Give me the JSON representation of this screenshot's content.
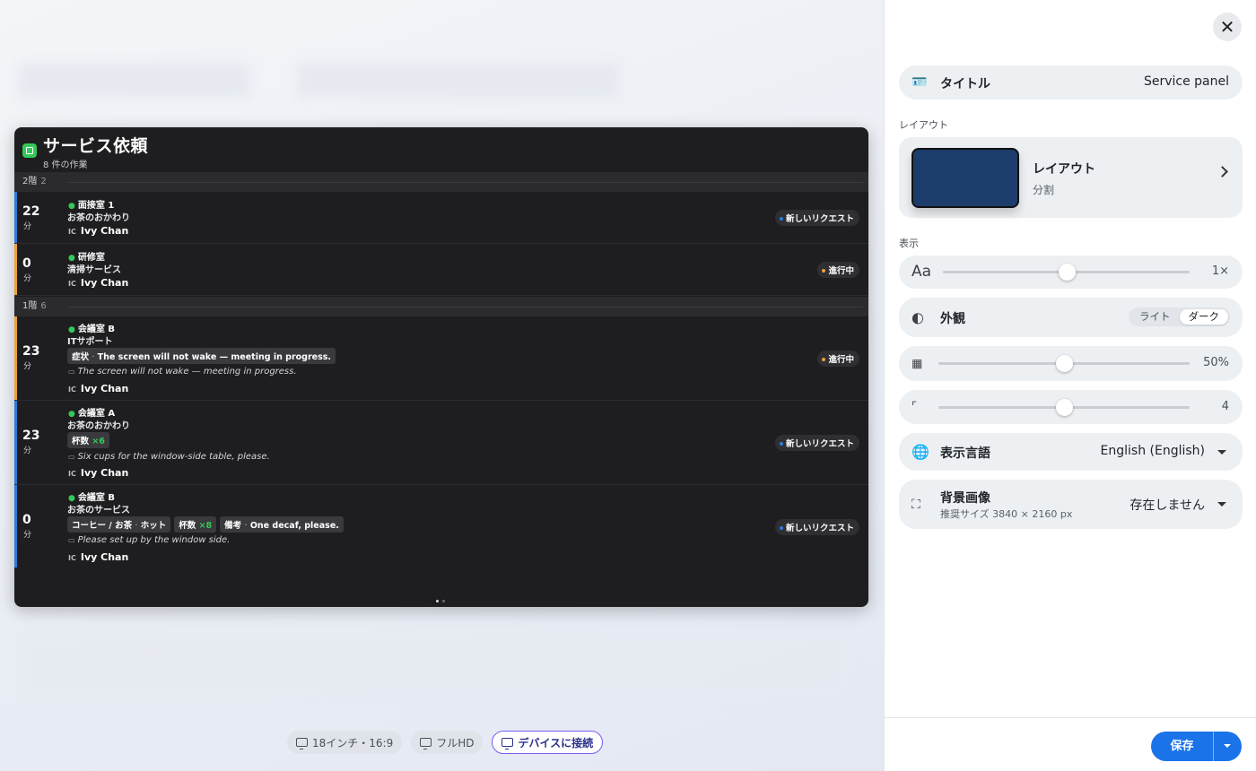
{
  "preview": {
    "title": "サービス依頼",
    "subtitle": "8 件の作業",
    "floors": [
      {
        "name": "2階",
        "count": "2"
      },
      {
        "name": "1階",
        "count": "6"
      }
    ],
    "requests": [
      {
        "minutes": "22",
        "unit": "分",
        "room": "面接室 1",
        "service": "お茶のおかわり",
        "assignee": "Ivy Chan",
        "initials": "IC",
        "status": "新しいリクエスト"
      },
      {
        "minutes": "0",
        "unit": "分",
        "room": "研修室",
        "service": "清掃サービス",
        "assignee": "Ivy Chan",
        "initials": "IC",
        "status": "進行中"
      },
      {
        "minutes": "23",
        "unit": "分",
        "room": "会議室 B",
        "service": "ITサポート",
        "chip_label": "症状",
        "chip_sep": "·",
        "chip_value": "The screen will not wake — meeting in progress.",
        "note": "The screen will not wake — meeting in progress.",
        "assignee": "Ivy Chan",
        "initials": "IC",
        "status": "進行中"
      },
      {
        "minutes": "23",
        "unit": "分",
        "room": "会議室 A",
        "service": "お茶のおかわり",
        "chip_label": "杯数",
        "chip_value": "×6",
        "note": "Six cups for the window-side table, please.",
        "assignee": "Ivy Chan",
        "initials": "IC",
        "status": "新しいリクエスト"
      },
      {
        "minutes": "0",
        "unit": "分",
        "room": "会議室 B",
        "service": "お茶のサービス",
        "chip1_label": "コーヒー / お茶",
        "chip1_sep": "·",
        "chip1_value": "ホット",
        "chip2_label": "杯数",
        "chip2_value": "×8",
        "chip3_label": "備考",
        "chip3_sep": "·",
        "chip3_value": "One decaf, please.",
        "note": "Please set up by the window side.",
        "assignee": "Ivy Chan",
        "initials": "IC",
        "status": "新しいリクエスト"
      }
    ]
  },
  "devices": {
    "size": "18インチ・16:9",
    "resolution": "フルHD",
    "connect": "デバイスに接続"
  },
  "panel": {
    "title_label": "タイトル",
    "title_value": "Service panel",
    "layout_section": "レイアウト",
    "layout_name": "レイアウト",
    "layout_sub": "分割",
    "display_section": "表示",
    "font_icon": "Aa",
    "font_scale": "1×",
    "font_scale_level": 0.5,
    "appearance_label": "外観",
    "appearance_options": [
      "ライト",
      "ダーク"
    ],
    "appearance_selected": "ダーク",
    "opacity_value": "50%",
    "opacity_level": 0.5,
    "radius_value": "4",
    "radius_level": 0.5,
    "language_label": "表示言語",
    "language_value": "English (English)",
    "bg_label": "背景画像",
    "bg_hint": "推奨サイズ 3840 × 2160 px",
    "bg_value": "存在しません",
    "save": "保存"
  },
  "colors": {
    "accent": "#1a73e8",
    "new_request": "#2f7bd8",
    "in_progress": "#e9a23b",
    "location_pin": "#34c759",
    "layout_thumb": "#1c3d6b"
  }
}
